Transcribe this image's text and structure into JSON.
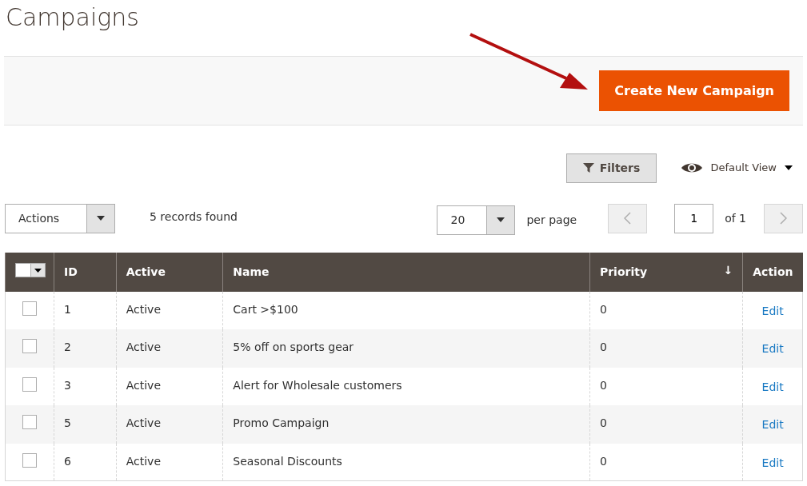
{
  "page_title": "Campaigns",
  "primary_action": {
    "label": "Create New Campaign"
  },
  "toolbar": {
    "filters": "Filters",
    "view": "Default View"
  },
  "mass_actions": {
    "label": "Actions"
  },
  "records": "5 records found",
  "pager": {
    "per_page_value": "20",
    "per_page_label": "per page",
    "page": "1",
    "of": "of 1"
  },
  "table": {
    "columns": [
      {
        "label": "ID"
      },
      {
        "label": "Active"
      },
      {
        "label": "Name"
      },
      {
        "label": "Priority",
        "sort": "↓"
      },
      {
        "label": "Action"
      }
    ],
    "rows": [
      {
        "checked": false,
        "cells": [
          "1",
          "Active",
          "Cart >$100",
          "0"
        ],
        "action": "Edit"
      },
      {
        "checked": false,
        "cells": [
          "2",
          "Active",
          "5% off on sports gear",
          "0"
        ],
        "action": "Edit"
      },
      {
        "checked": false,
        "cells": [
          "3",
          "Active",
          "Alert for Wholesale customers",
          "0"
        ],
        "action": "Edit"
      },
      {
        "checked": false,
        "cells": [
          "5",
          "Active",
          "Promo Campaign",
          "0"
        ],
        "action": "Edit"
      },
      {
        "checked": false,
        "cells": [
          "6",
          "Active",
          "Seasonal Discounts",
          "0"
        ],
        "action": "Edit"
      }
    ]
  }
}
